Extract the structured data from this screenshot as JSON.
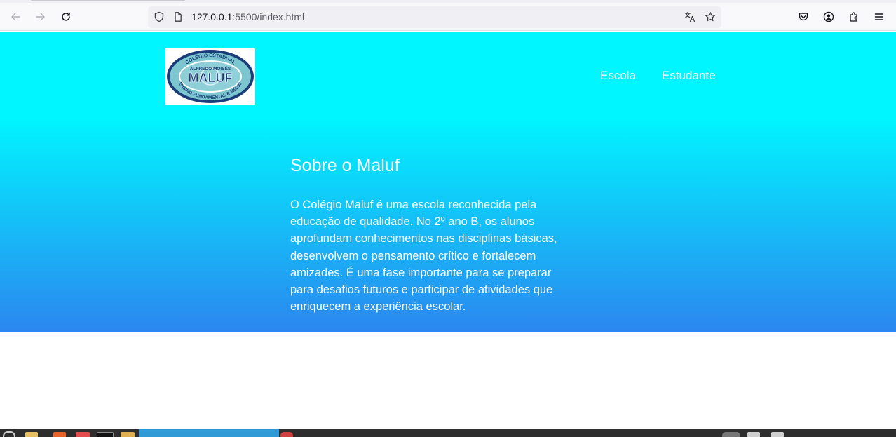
{
  "browser": {
    "url_host": "127.0.0.1",
    "url_rest": ":5500/index.html",
    "icons": {
      "back": "back-arrow-icon",
      "forward": "forward-arrow-icon",
      "reload": "reload-icon",
      "shield": "tracking-shield-icon",
      "page": "page-icon",
      "translate": "translate-icon",
      "bookmark": "star-icon",
      "pocket": "pocket-icon",
      "account": "account-icon",
      "extensions": "extensions-icon",
      "menu": "hamburger-menu-icon"
    }
  },
  "site": {
    "logo": {
      "arc_top": "COLÉGIO ESTADUAL",
      "name_small": "ALFREDO MOISÉS",
      "name_big": "MALUF",
      "arc_bottom": "ENSINO FUNDAMENTAL E MÉDIO"
    },
    "nav": {
      "escola": "Escola",
      "estudante": "Estudante"
    },
    "about": {
      "title": "Sobre o Maluf",
      "lines": [
        "O Colégio Maluf é uma escola reconhecida pela",
        "educação de qualidade. No 2º ano B, os alunos",
        "aprofundam conhecimentos nas disciplinas básicas,",
        "desenvolvem o pensamento crítico e fortalecem",
        "amizades. É uma fase importante para se preparar",
        "para desafios futuros e participar de atividades que",
        "enriquecem a experiência escolar."
      ]
    },
    "colors": {
      "gradient_top": "#00f6ff",
      "gradient_bottom": "#2b86ef",
      "text": "#ffffff"
    }
  }
}
